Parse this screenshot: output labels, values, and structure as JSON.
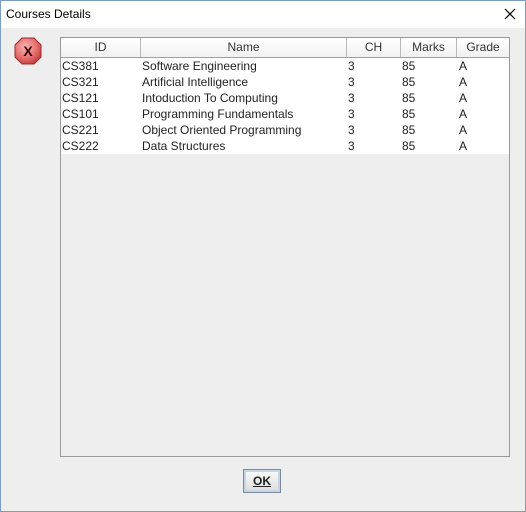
{
  "window": {
    "title": "Courses Details",
    "close_icon": "close-icon"
  },
  "message": {
    "icon": "error-icon",
    "icon_color": "#c43c3c"
  },
  "table": {
    "columns": [
      "ID",
      "Name",
      "CH",
      "Marks",
      "Grade"
    ],
    "rows": [
      [
        "CS381",
        "Software Engineering",
        "3",
        "85",
        "A"
      ],
      [
        "CS321",
        "Artificial Intelligence",
        "3",
        "85",
        "A"
      ],
      [
        "CS121",
        "Intoduction To Computing",
        "3",
        "85",
        "A"
      ],
      [
        "CS101",
        "Programming Fundamentals",
        "3",
        "85",
        "A"
      ],
      [
        "CS221",
        "Object Oriented Programming",
        "3",
        "85",
        "A"
      ],
      [
        "CS222",
        "Data Structures",
        "3",
        "85",
        "A"
      ]
    ]
  },
  "buttons": {
    "ok_label": "OK"
  }
}
